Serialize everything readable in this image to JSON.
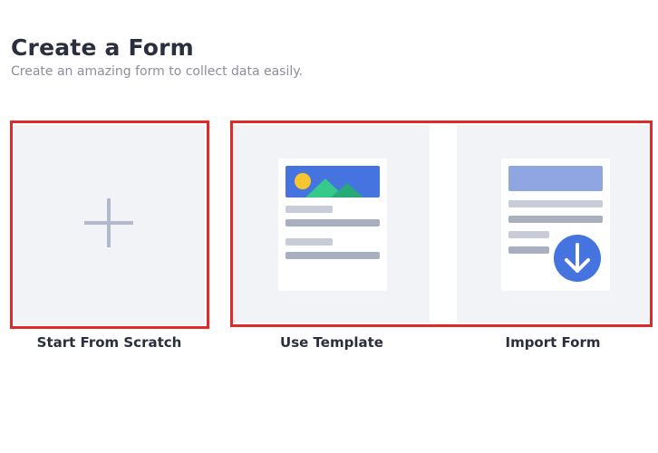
{
  "header": {
    "title": "Create a Form",
    "subtitle": "Create an amazing form to collect data easily."
  },
  "options": [
    {
      "label": "Start From Scratch",
      "icon": "plus-icon"
    },
    {
      "label": "Use Template",
      "icon": "template-document-icon"
    },
    {
      "label": "Import Form",
      "icon": "import-document-icon"
    }
  ],
  "colors": {
    "card_background": "#f2f3f7",
    "highlight_border": "#e02a2a",
    "accent_blue": "#4573e0",
    "accent_green": "#35c98a",
    "accent_yellow": "#f7c52d",
    "placeholder_gray": "#a8afbf"
  }
}
